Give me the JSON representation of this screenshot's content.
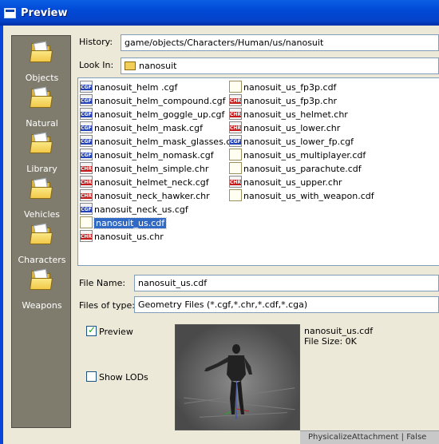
{
  "window": {
    "title": "Preview"
  },
  "places": [
    {
      "label": "Objects"
    },
    {
      "label": "Natural"
    },
    {
      "label": "Library"
    },
    {
      "label": "Vehicles"
    },
    {
      "label": "Characters"
    },
    {
      "label": "Weapons"
    }
  ],
  "history": {
    "label": "History:",
    "value": "game/objects/Characters/Human/us/nanosuit"
  },
  "look_in": {
    "label": "Look In:",
    "value": "nanosuit"
  },
  "files_left": [
    {
      "name": "nanosuit_helm .cgf",
      "icon": "cgf-file-icon"
    },
    {
      "name": "nanosuit_helm_compound.cgf",
      "icon": "cgf-file-icon"
    },
    {
      "name": "nanosuit_helm_goggle_up.cgf",
      "icon": "cgf-file-icon"
    },
    {
      "name": "nanosuit_helm_mask.cgf",
      "icon": "cgf-file-icon"
    },
    {
      "name": "nanosuit_helm_mask_glasses.cgf",
      "icon": "cgf-file-icon"
    },
    {
      "name": "nanosuit_helm_nomask.cgf",
      "icon": "cgf-file-icon"
    },
    {
      "name": "nanosuit_helm_simple.chr",
      "icon": "chr-file-icon"
    },
    {
      "name": "nanosuit_helmet_neck.cgf",
      "icon": "chr-file-icon"
    },
    {
      "name": "nanosuit_neck_hawker.chr",
      "icon": "chr-file-icon"
    },
    {
      "name": "nanosuit_neck_us.cgf",
      "icon": "cgf-file-icon"
    },
    {
      "name": "nanosuit_us.cdf",
      "icon": "cdf-file-icon",
      "selected": true
    },
    {
      "name": "nanosuit_us.chr",
      "icon": "chr-file-icon"
    }
  ],
  "files_right": [
    {
      "name": "nanosuit_us_fp3p.cdf",
      "icon": "cdf-file-icon"
    },
    {
      "name": "nanosuit_us_fp3p.chr",
      "icon": "chr-file-icon"
    },
    {
      "name": "nanosuit_us_helmet.chr",
      "icon": "chr-file-icon"
    },
    {
      "name": "nanosuit_us_lower.chr",
      "icon": "chr-file-icon"
    },
    {
      "name": "nanosuit_us_lower_fp.cgf",
      "icon": "cgf-file-icon"
    },
    {
      "name": "nanosuit_us_multiplayer.cdf",
      "icon": "cdf-file-icon"
    },
    {
      "name": "nanosuit_us_parachute.cdf",
      "icon": "cdf-file-icon"
    },
    {
      "name": "nanosuit_us_upper.chr",
      "icon": "chr-file-icon"
    },
    {
      "name": "nanosuit_us_with_weapon.cdf",
      "icon": "cdf-file-icon"
    }
  ],
  "file_name": {
    "label": "File Name:",
    "value": "nanosuit_us.cdf"
  },
  "files_of_type": {
    "label": "Files of type:",
    "value": "Geometry Files (*.cgf,*.chr,*.cdf,*.cga)"
  },
  "preview_check": {
    "label": "Preview",
    "checked": true
  },
  "show_lods_check": {
    "label": "Show LODs",
    "checked": false
  },
  "preview_info": {
    "filename": "nanosuit_us.cdf",
    "filesize": "File Size: 0K"
  },
  "taskbar": {
    "text": "PhysicalizeAttachment | False"
  }
}
